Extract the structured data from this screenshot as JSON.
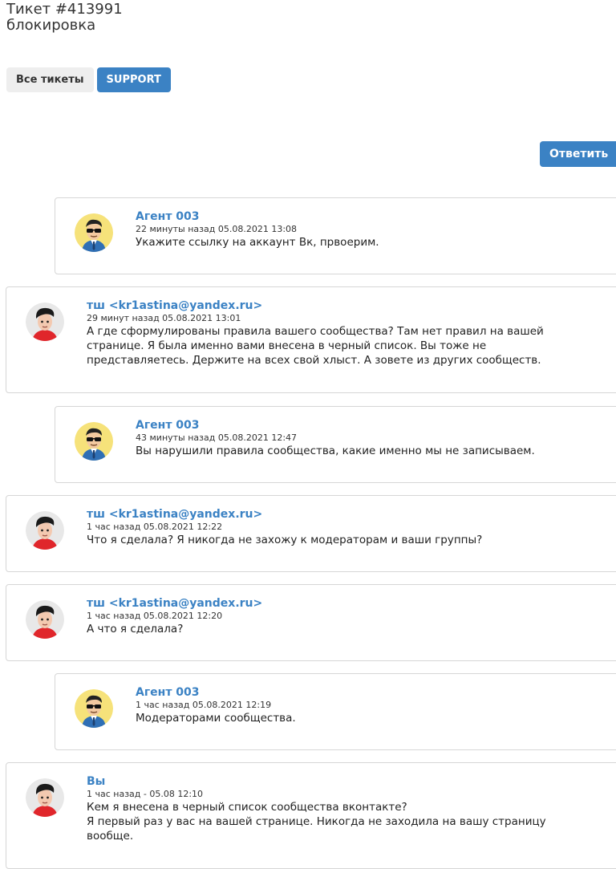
{
  "ticket": {
    "title": "Тикет #413991",
    "subject": "блокировка"
  },
  "tabs": {
    "all_label": "Все тикеты",
    "support_label": "SUPPORT"
  },
  "reply_label": "Ответить",
  "colors": {
    "accent": "#3b82c4",
    "agent_avatar_bg": "#f6e27a",
    "user_avatar_bg": "#e8e8e8"
  },
  "messages": [
    {
      "type": "agent",
      "author": "Агент 003",
      "time": "22 минуты назад 05.08.2021 13:08",
      "lines": [
        "Укажите ссылку на аккаунт Вк, првоерим."
      ]
    },
    {
      "type": "user",
      "author": "тш <kr1astina@yandex.ru>",
      "time": "29 минут назад 05.08.2021 13:01",
      "lines": [
        "А где сформулированы правила вашего сообщества? Там нет правил на вашей",
        "странице. Я была именно вами внесена в черный список. Вы тоже не",
        "представляетесь. Держите на всех свой хлыст. А зовете из других сообществ."
      ]
    },
    {
      "type": "agent",
      "author": "Агент 003",
      "time": "43 минуты назад 05.08.2021 12:47",
      "lines": [
        "Вы нарушили правила сообщества, какие именно мы не записываем."
      ]
    },
    {
      "type": "user",
      "author": "тш <kr1astina@yandex.ru>",
      "time": "1 час назад 05.08.2021 12:22",
      "lines": [
        "Что я сделала? Я никогда не захожу к модераторам и ваши группы?"
      ]
    },
    {
      "type": "user",
      "author": "тш <kr1astina@yandex.ru>",
      "time": "1 час назад 05.08.2021 12:20",
      "lines": [
        "А что я сделала?"
      ]
    },
    {
      "type": "agent",
      "author": "Агент 003",
      "time": "1 час назад 05.08.2021 12:19",
      "lines": [
        "Модераторами сообщества."
      ]
    },
    {
      "type": "user",
      "author": "Вы",
      "time": "1 час назад - 05.08 12:10",
      "lines": [
        "Кем я внесена в черный список сообщества вконтакте?",
        "Я первый раз у вас на вашей странице. Никогда не заходила на вашу страницу",
        "вообще."
      ]
    }
  ]
}
